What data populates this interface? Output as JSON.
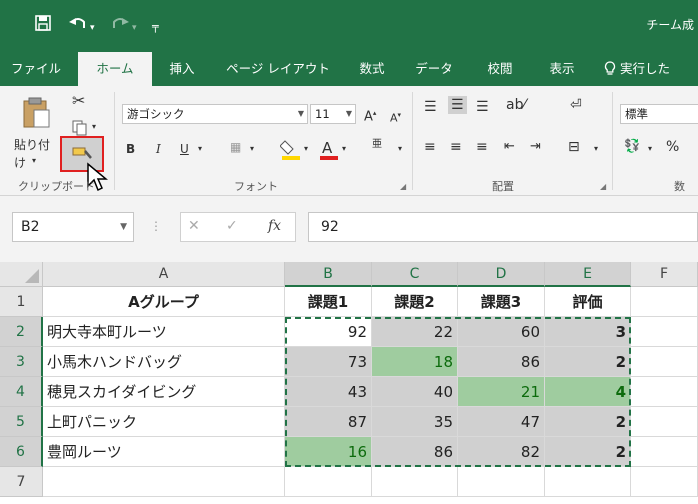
{
  "window": {
    "title": "チーム成"
  },
  "qat": {
    "save_icon": "save-icon",
    "undo_icon": "undo-icon",
    "redo_icon": "redo-icon"
  },
  "tabs": [
    {
      "label": "ファイル",
      "active": false
    },
    {
      "label": "ホーム",
      "active": true
    },
    {
      "label": "挿入",
      "active": false
    },
    {
      "label": "ページ レイアウト",
      "active": false
    },
    {
      "label": "数式",
      "active": false
    },
    {
      "label": "データ",
      "active": false
    },
    {
      "label": "校閲",
      "active": false
    },
    {
      "label": "表示",
      "active": false
    }
  ],
  "tell_me": {
    "icon": "lightbulb-icon",
    "label": "実行した"
  },
  "ribbon": {
    "clipboard": {
      "paste_label": "貼り付け",
      "group_label": "クリップボード"
    },
    "font": {
      "family": "游ゴシック",
      "size": "11",
      "group_label": "フォント"
    },
    "alignment": {
      "group_label": "配置"
    },
    "number": {
      "format": "標準",
      "group_label": "数",
      "percent": "%"
    }
  },
  "formula_bar": {
    "name_box": "B2",
    "formula": "92"
  },
  "grid": {
    "columns": [
      "A",
      "B",
      "C",
      "D",
      "E",
      "F"
    ],
    "selected_columns": [
      "B",
      "C",
      "D",
      "E"
    ],
    "rows": [
      "1",
      "2",
      "3",
      "4",
      "5",
      "6",
      "7"
    ],
    "selected_rows": [
      "2",
      "3",
      "4",
      "5",
      "6"
    ],
    "headers": [
      "Aグループ",
      "課題1",
      "課題2",
      "課題3",
      "評価"
    ],
    "data": [
      {
        "name": "明大寺本町ルーツ",
        "k1": "92",
        "k2": "22",
        "k3": "60",
        "eval": "3"
      },
      {
        "name": "小馬木ハンドバッグ",
        "k1": "73",
        "k2": "18",
        "k3": "86",
        "eval": "2"
      },
      {
        "name": "穂見スカイダイビング",
        "k1": "43",
        "k2": "40",
        "k3": "21",
        "eval": "4"
      },
      {
        "name": "上町パニック",
        "k1": "87",
        "k2": "35",
        "k3": "47",
        "eval": "2"
      },
      {
        "name": "豊岡ルーツ",
        "k1": "16",
        "k2": "86",
        "k3": "82",
        "eval": "2"
      }
    ]
  },
  "colors": {
    "excel_green": "#217346",
    "highlight_green": "#9fcc9f",
    "selection_gray": "#d0d0d0"
  }
}
